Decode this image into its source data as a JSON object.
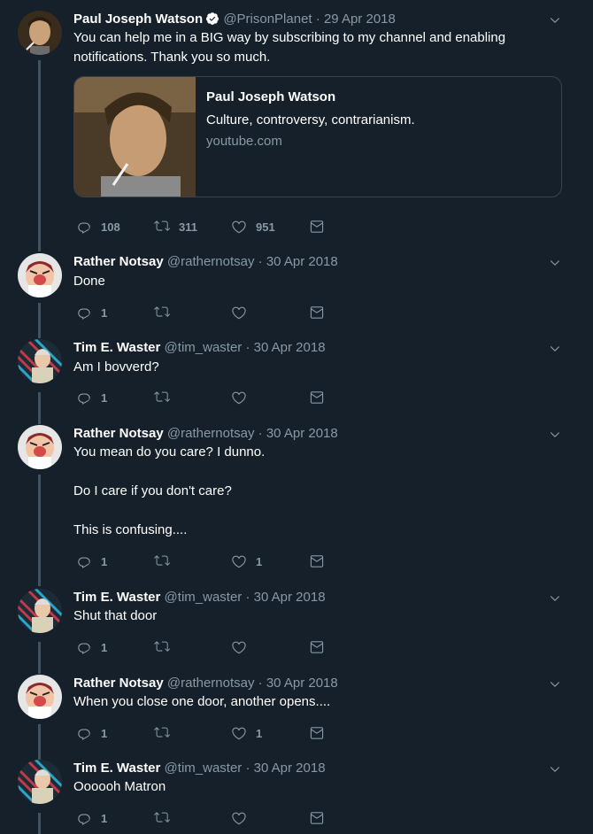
{
  "tweets": [
    {
      "name": "Paul Joseph Watson",
      "handle": "@PrisonPlanet",
      "dot": "·",
      "date": "29 Apr 2018",
      "text": "You can help me in a BIG way by subscribing to my channel and enabling notifications. Thank you so much.",
      "reply_count": "108",
      "retweet_count": "311",
      "like_count": "951",
      "card": {
        "title": "Paul Joseph Watson",
        "description": "Culture, controversy, contrarianism.",
        "domain": "youtube.com"
      }
    },
    {
      "name": "Rather Notsay",
      "handle": "@rathernotsay",
      "dot": "·",
      "date": "30 Apr 2018",
      "text": "Done",
      "reply_count": "1",
      "retweet_count": "",
      "like_count": ""
    },
    {
      "name": "Tim E. Waster",
      "handle": "@tim_waster",
      "dot": "·",
      "date": "30 Apr 2018",
      "text": "Am I bovverd?",
      "reply_count": "1",
      "retweet_count": "",
      "like_count": ""
    },
    {
      "name": "Rather Notsay",
      "handle": "@rathernotsay",
      "dot": "·",
      "date": "30 Apr 2018",
      "text": "You mean do you care? I dunno.\n\nDo I care if you don't care?\n\nThis is confusing....",
      "reply_count": "1",
      "retweet_count": "",
      "like_count": "1"
    },
    {
      "name": "Tim E. Waster",
      "handle": "@tim_waster",
      "dot": "·",
      "date": "30 Apr 2018",
      "text": "Shut that door",
      "reply_count": "1",
      "retweet_count": "",
      "like_count": ""
    },
    {
      "name": "Rather Notsay",
      "handle": "@rathernotsay",
      "dot": "·",
      "date": "30 Apr 2018",
      "text": "When you close one door, another opens....",
      "reply_count": "1",
      "retweet_count": "",
      "like_count": "1"
    },
    {
      "name": "Tim E. Waster",
      "handle": "@tim_waster",
      "dot": "·",
      "date": "30 Apr 2018",
      "text": "Oooooh Matron",
      "reply_count": "1",
      "retweet_count": "",
      "like_count": ""
    }
  ],
  "icons": {
    "reply": "reply-icon",
    "retweet": "retweet-icon",
    "like": "heart-icon",
    "dm": "envelope-icon",
    "menu": "chevron-down-icon",
    "verified": "verified-badge-icon"
  },
  "colors": {
    "background": "#15202b",
    "secondary_text": "#8899a6",
    "thread_line": "#3d5466",
    "verified": "#ffffff"
  }
}
